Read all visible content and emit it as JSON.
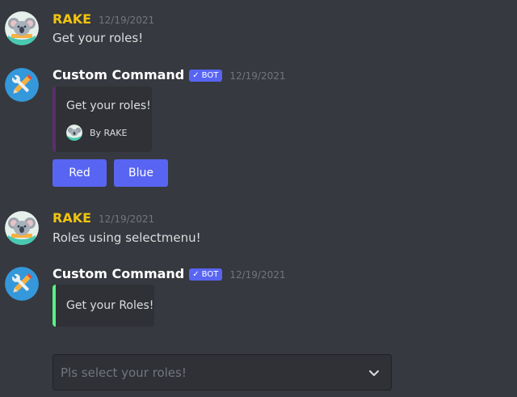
{
  "messages": [
    {
      "author": "RAKE",
      "timestamp": "12/19/2021",
      "content": "Get your roles!"
    },
    {
      "author": "Custom Command",
      "bot_tag": "BOT",
      "timestamp": "12/19/2021",
      "embed": {
        "description": "Get your roles!",
        "footer": "By RAKE"
      },
      "buttons": [
        "Red",
        "Blue"
      ]
    },
    {
      "author": "RAKE",
      "timestamp": "12/19/2021",
      "content": "Roles using selectmenu!"
    },
    {
      "author": "Custom Command",
      "bot_tag": "BOT",
      "timestamp": "12/19/2021",
      "embed": {
        "description": "Get your Roles!"
      },
      "select_menu": {
        "placeholder": "Pls select your roles!"
      }
    }
  ],
  "colors": {
    "background": "#36393f",
    "embed_background": "#2f3136",
    "button": "#5865f2",
    "rake_name": "#f1c40f",
    "embed_border_1": "#5c2d6e",
    "embed_border_2": "#57f287"
  },
  "icons": {
    "rake_avatar": "koala-avatar-icon",
    "bot_avatar": "wrench-pencil-icon",
    "bot_check": "check-icon",
    "select_chevron": "chevron-down-icon"
  }
}
